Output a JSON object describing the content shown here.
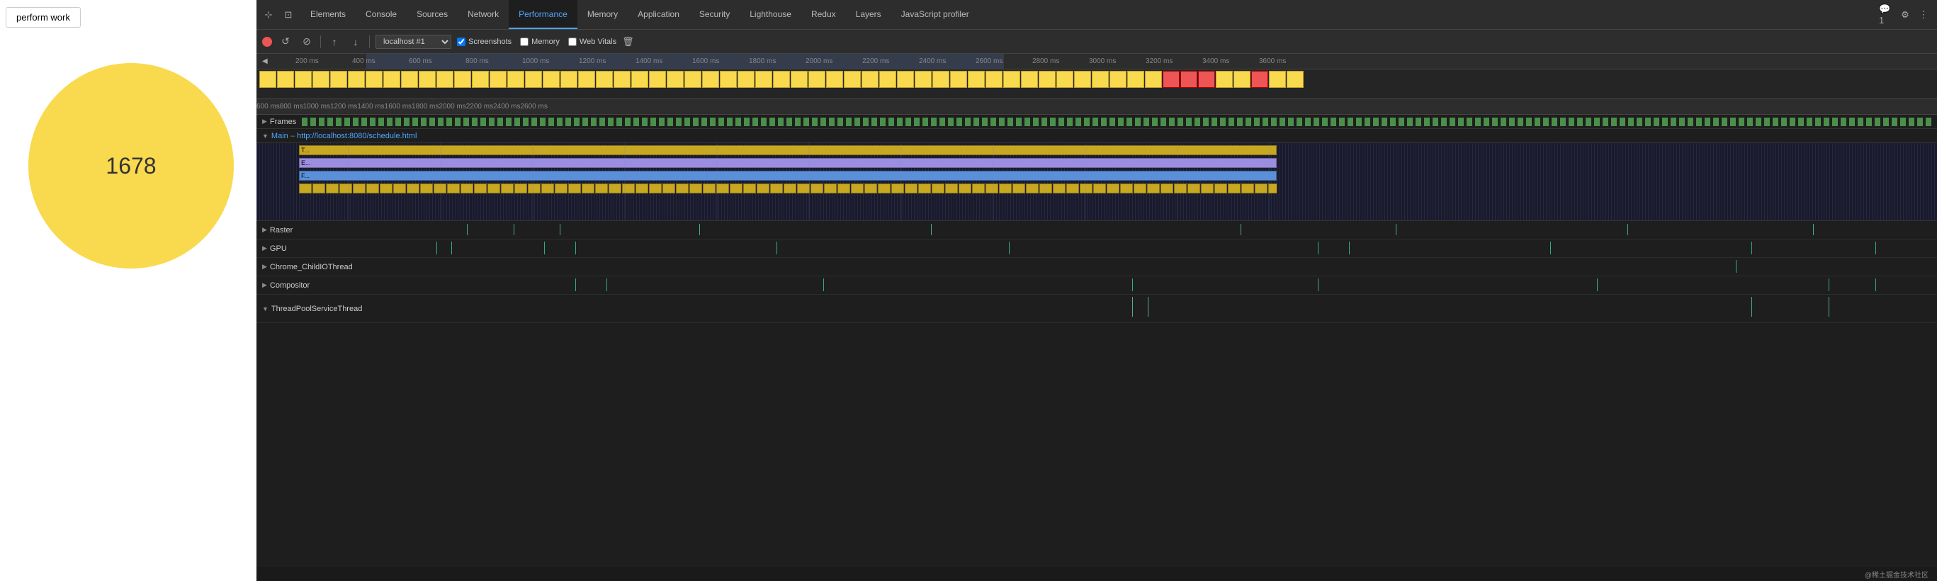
{
  "left": {
    "button_label": "perform work",
    "circle_number": "1678"
  },
  "devtools": {
    "tabs": [
      {
        "label": "Elements",
        "active": false
      },
      {
        "label": "Console",
        "active": false
      },
      {
        "label": "Sources",
        "active": false
      },
      {
        "label": "Network",
        "active": false
      },
      {
        "label": "Performance",
        "active": true
      },
      {
        "label": "Memory",
        "active": false
      },
      {
        "label": "Application",
        "active": false
      },
      {
        "label": "Security",
        "active": false
      },
      {
        "label": "Lighthouse",
        "active": false
      },
      {
        "label": "Redux",
        "active": false
      },
      {
        "label": "Layers",
        "active": false
      },
      {
        "label": "JavaScript profiler",
        "active": false
      }
    ],
    "toolbar2": {
      "url": "localhost #1",
      "checkboxes": [
        {
          "label": "Screenshots",
          "checked": true
        },
        {
          "label": "Memory",
          "checked": false
        },
        {
          "label": "Web Vitals",
          "checked": false
        }
      ]
    },
    "ruler_labels_top": [
      "200 ms",
      "400 ms",
      "600 ms",
      "800 ms",
      "1000 ms",
      "1200 ms",
      "1400 ms",
      "1600 ms",
      "1800 ms",
      "2000 ms",
      "2200 ms",
      "2400 ms",
      "2600 ms",
      "2800 ms",
      "3000 ms",
      "3200 ms",
      "3400 ms",
      "3600 ms"
    ],
    "ruler_labels_bottom": [
      "600 ms",
      "800 ms",
      "1000 ms",
      "1200 ms",
      "1400 ms",
      "1600 ms",
      "1800 ms",
      "2000 ms",
      "2200 ms",
      "2400 ms",
      "2600 ms"
    ],
    "frames_label": "Frames",
    "main_label": "Main",
    "main_url": "http://localhost:8080/schedule.html",
    "flame_rows": [
      {
        "label": "T...",
        "color": "gold"
      },
      {
        "label": "E...",
        "color": "purple"
      },
      {
        "label": "F...",
        "color": "blue"
      }
    ],
    "threads": [
      {
        "name": "Raster",
        "expanded": false
      },
      {
        "name": "GPU",
        "expanded": false
      },
      {
        "name": "Chrome_ChildIOThread",
        "expanded": false
      },
      {
        "name": "Compositor",
        "expanded": false
      },
      {
        "name": "ThreadPoolServiceThread",
        "expanded": true
      }
    ],
    "footer_text": "@稀土掘金技术社区"
  }
}
